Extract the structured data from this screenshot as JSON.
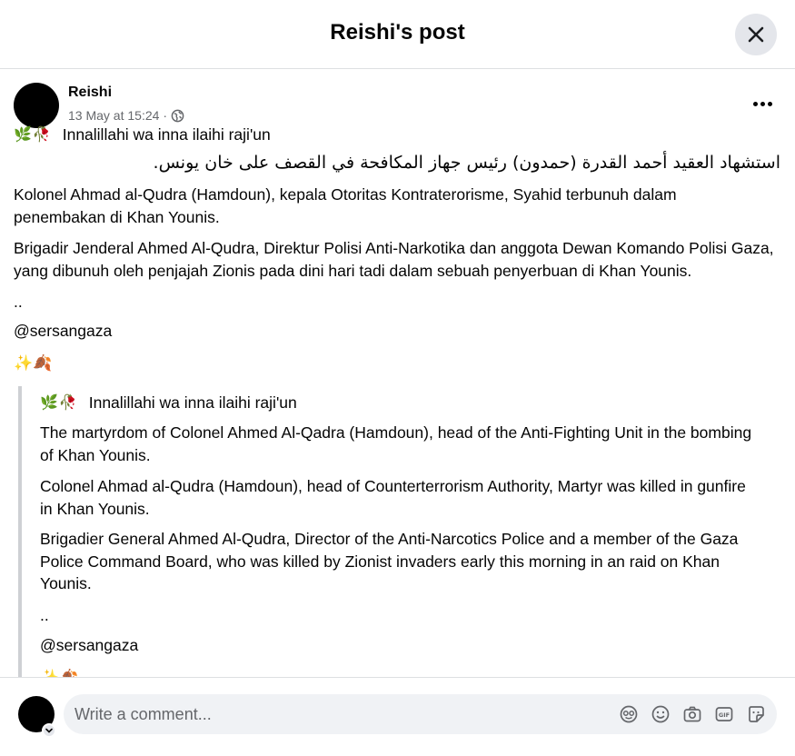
{
  "dialog": {
    "title": "Reishi's post"
  },
  "post": {
    "author": "Reishi",
    "timestamp": "13 May at 15:24",
    "meta_separator": "·",
    "first_line": "Innalillahi wa inna ilaihi raji'un",
    "arabic_line": "استشهاد العقيد أحمد القدرة (حمدون)  رئيس جهاز المكافحة في القصف على خان يونس.",
    "para_1": "Kolonel Ahmad al-Qudra (Hamdoun), kepala Otoritas Kontraterorisme, Syahid terbunuh dalam penembakan di Khan Younis.",
    "para_2": "Brigadir Jenderal Ahmed Al-Qudra, Direktur Polisi Anti-Narkotika dan anggota Dewan Komando Polisi Gaza, yang dibunuh oleh penjajah Zionis pada dini hari tadi dalam sebuah penyerbuan di Khan Younis.",
    "dots": "..",
    "mention": "@sersangaza",
    "emoji_sparkle": "✨",
    "emoji_leaf": "🍂",
    "emoji_herb": "🌿",
    "emoji_rose": "🥀"
  },
  "translation": {
    "first_line": "Innalillahi wa inna ilaihi raji'un",
    "para_1": "The martyrdom of Colonel Ahmed Al-Qadra (Hamdoun), head of the Anti-Fighting Unit in the bombing of Khan Younis.",
    "para_2": "Colonel Ahmad al-Qudra (Hamdoun), head of Counterterrorism Authority, Martyr was killed in gunfire in Khan Younis.",
    "para_3": "Brigadier General Ahmed Al-Qudra, Director of the Anti-Narcotics Police and a member of the Gaza Police Command Board, who was killed by Zionist invaders early this morning in an raid on Khan Younis.",
    "dots": "..",
    "mention": "@sersangaza"
  },
  "comment": {
    "placeholder": "Write a comment..."
  },
  "icons": {
    "close": "close-icon",
    "more": "more-options-icon",
    "privacy": "globe-icon",
    "avatar_sticker": "avatar-sticker-icon",
    "emoji": "emoji-icon",
    "camera": "camera-icon",
    "gif": "gif-icon",
    "sticker": "sticker-icon"
  }
}
